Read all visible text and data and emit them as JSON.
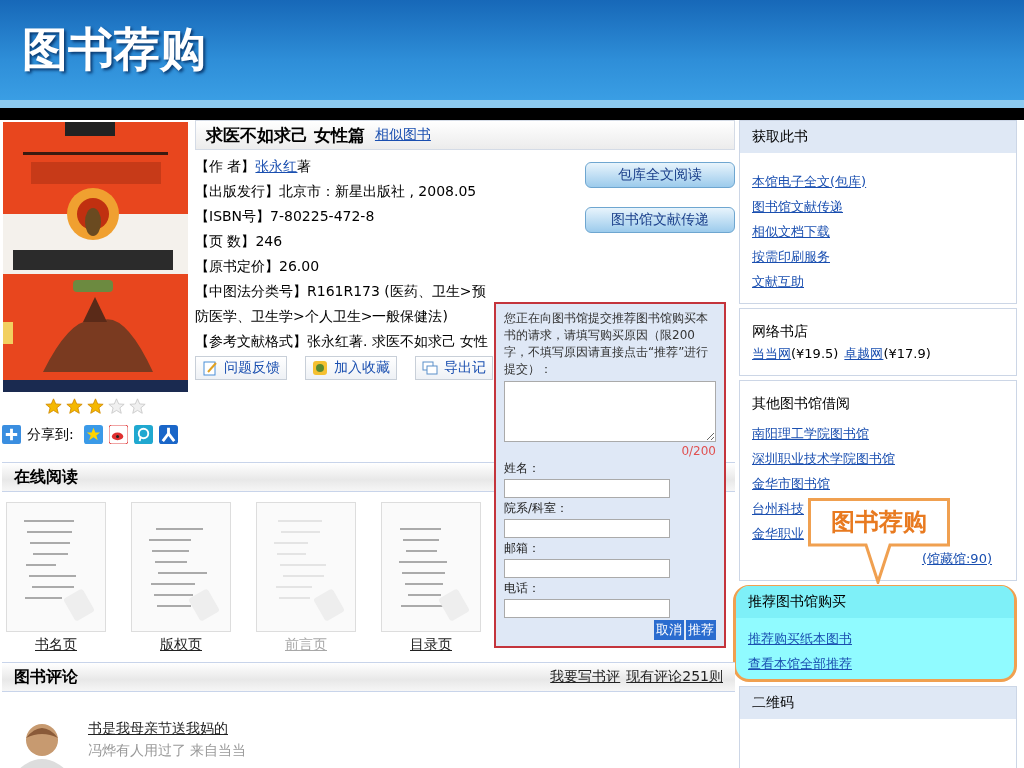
{
  "slide": {
    "title": "图书荐购"
  },
  "book": {
    "title": "求医不如求己 女性篇",
    "similar_link": "相似图书",
    "stars": 3,
    "fields": [
      {
        "label": "【作 者】",
        "link": "张永红",
        "value": "著"
      },
      {
        "label": "【出版发行】",
        "value": "北京市：新星出版社 , 2008.05"
      },
      {
        "label": "【ISBN号】",
        "value": "7-80225-472-8"
      },
      {
        "label": "【页 数】",
        "value": "246"
      },
      {
        "label": "【原书定价】",
        "value": "26.00"
      },
      {
        "label": "【中图法分类号】",
        "value": "R161R173 (医药、卫生>预防医学、卫生学>个人卫生>一般保健法)"
      },
      {
        "label": "【参考文献格式】",
        "value": "张永红著. 求医不如求己 女性"
      }
    ],
    "buttons": [
      "包库全文阅读",
      "图书馆文献传递"
    ],
    "actions": [
      {
        "kind": "feedback",
        "label": "问题反馈"
      },
      {
        "kind": "favorite",
        "label": "加入收藏"
      },
      {
        "kind": "export",
        "label": "导出记"
      }
    ],
    "share_label": "分享到:"
  },
  "reading": {
    "title": "在线阅读",
    "pages": [
      {
        "label": "书名页",
        "disabled": false
      },
      {
        "label": "版权页",
        "disabled": false
      },
      {
        "label": "前言页",
        "disabled": true
      },
      {
        "label": "目录页",
        "disabled": false
      }
    ]
  },
  "reviews": {
    "title": "图书评论",
    "write_link": "我要写书评",
    "count_link": "现有评论251则",
    "items": [
      {
        "title": "书是我母亲节送我妈的",
        "meta": "冯烨有人用过了 来自当当"
      }
    ]
  },
  "popup": {
    "prompt": "您正在向图书馆提交推荐图书馆购买本书的请求，请填写购买原因（限200字，不填写原因请直接点击“推荐”进行提交）：",
    "counter": "0/200",
    "fields": [
      "姓名：",
      "院系/科室：",
      "邮箱：",
      "电话："
    ],
    "buttons": [
      "取消",
      "推荐"
    ]
  },
  "sidebar": [
    {
      "kind": "links",
      "title": "获取此书",
      "header": true,
      "highlighted": false,
      "links": [
        "本馆电子全文(包库)",
        "图书馆文献传递",
        "相似文档下载",
        "按需印刷服务",
        "文献互助"
      ]
    },
    {
      "kind": "stores",
      "title": "网络书店",
      "header": false,
      "highlighted": false,
      "stores": [
        {
          "name": "当当网",
          "price": "(¥19.5)"
        },
        {
          "name": "卓越网",
          "price": "(¥17.9)"
        }
      ]
    },
    {
      "kind": "links",
      "title": "其他图书馆借阅",
      "header": false,
      "highlighted": false,
      "links": [
        "南阳理工学院图书馆",
        "深圳职业技术学院图书馆",
        "金华市图书馆",
        "台州科技",
        "金华职业"
      ],
      "more": "(馆藏馆:90)"
    },
    {
      "kind": "links",
      "title": "推荐图书馆购买",
      "header": true,
      "highlighted": true,
      "links": [
        "推荐购买纸本图书",
        "查看本馆全部推荐"
      ]
    },
    {
      "kind": "empty",
      "title": "二维码",
      "header": true,
      "highlighted": false
    }
  ],
  "callout": {
    "text": "图书荐购"
  }
}
